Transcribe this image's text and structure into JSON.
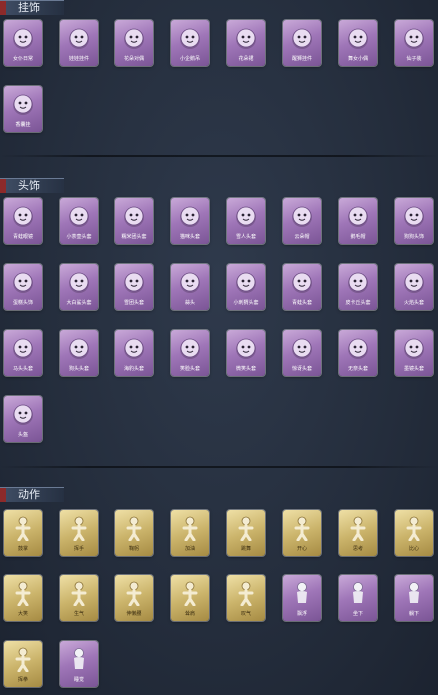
{
  "sections": [
    {
      "id": "pendant",
      "title": "挂饰",
      "items": [
        {
          "label": "女仆日常",
          "icon": "doll-icon",
          "tone": "purple"
        },
        {
          "label": "娃娃挂件",
          "icon": "girl-doll-icon",
          "tone": "purple"
        },
        {
          "label": "花朵对偶",
          "icon": "flower-doll-icon",
          "tone": "purple"
        },
        {
          "label": "小企鹅吊",
          "icon": "penguin-icon",
          "tone": "purple"
        },
        {
          "label": "花朵裙",
          "icon": "flower-dress-icon",
          "tone": "purple"
        },
        {
          "label": "醒狮挂件",
          "icon": "lion-icon",
          "tone": "purple"
        },
        {
          "label": "舞女小偶",
          "icon": "dancer-icon",
          "tone": "purple"
        },
        {
          "label": "仙子装",
          "icon": "fairy-icon",
          "tone": "purple"
        },
        {
          "label": "香囊挂",
          "icon": "sachet-icon",
          "tone": "purple"
        }
      ]
    },
    {
      "id": "headwear",
      "title": "头饰",
      "items": [
        {
          "label": "青蛙眼镜",
          "icon": "frog-icon",
          "tone": "purple"
        },
        {
          "label": "小茶壶头套",
          "icon": "teapot-icon",
          "tone": "purple"
        },
        {
          "label": "糯米团头套",
          "icon": "rice-ball-icon",
          "tone": "purple"
        },
        {
          "label": "猫咪头套",
          "icon": "cat-head-icon",
          "tone": "purple"
        },
        {
          "label": "雪人头套",
          "icon": "snowman-icon",
          "tone": "purple"
        },
        {
          "label": "云朵帽",
          "icon": "cloud-icon",
          "tone": "purple"
        },
        {
          "label": "鹅毛帽",
          "icon": "bird-icon",
          "tone": "purple"
        },
        {
          "label": "狗狗头饰",
          "icon": "dog-head-icon",
          "tone": "purple"
        },
        {
          "label": "蛋糕头饰",
          "icon": "cake-icon",
          "tone": "purple"
        },
        {
          "label": "大白鲨头套",
          "icon": "shark-icon",
          "tone": "purple"
        },
        {
          "label": "雪团头套",
          "icon": "snowball-icon",
          "tone": "purple"
        },
        {
          "label": "蒜头",
          "icon": "garlic-icon",
          "tone": "purple"
        },
        {
          "label": "小刺猬头套",
          "icon": "hedgehog-icon",
          "tone": "purple"
        },
        {
          "label": "青蛙头套",
          "icon": "green-frog-icon",
          "tone": "purple"
        },
        {
          "label": "皮卡丘头套",
          "icon": "pikachu-icon",
          "tone": "purple"
        },
        {
          "label": "火焰头套",
          "icon": "fire-icon",
          "tone": "purple"
        },
        {
          "label": "马头头套",
          "icon": "horse-icon",
          "tone": "purple"
        },
        {
          "label": "狗头头套",
          "icon": "doberman-icon",
          "tone": "purple"
        },
        {
          "label": "海豹头套",
          "icon": "seal-icon",
          "tone": "purple"
        },
        {
          "label": "笑脸头套",
          "icon": "grin-icon",
          "tone": "purple"
        },
        {
          "label": "微笑头套",
          "icon": "smile-icon",
          "tone": "purple"
        },
        {
          "label": "惊讶头套",
          "icon": "surprise-icon",
          "tone": "purple"
        },
        {
          "label": "无奈头套",
          "icon": "meh-icon",
          "tone": "purple"
        },
        {
          "label": "墨镜头套",
          "icon": "sunglasses-icon",
          "tone": "purple"
        },
        {
          "label": "头盔",
          "icon": "helmet-icon",
          "tone": "purple"
        }
      ]
    },
    {
      "id": "action",
      "title": "动作",
      "items": [
        {
          "label": "鼓掌",
          "icon": "pose-icon",
          "tone": "gold"
        },
        {
          "label": "挥手",
          "icon": "pose-icon",
          "tone": "gold"
        },
        {
          "label": "鞠躬",
          "icon": "pose-icon",
          "tone": "gold"
        },
        {
          "label": "加油",
          "icon": "pose-icon",
          "tone": "gold"
        },
        {
          "label": "跳舞",
          "icon": "pose-icon",
          "tone": "gold"
        },
        {
          "label": "开心",
          "icon": "pose-icon",
          "tone": "gold"
        },
        {
          "label": "思考",
          "icon": "pose-icon",
          "tone": "gold"
        },
        {
          "label": "比心",
          "icon": "pose-icon",
          "tone": "gold"
        },
        {
          "label": "大笑",
          "icon": "pose-icon",
          "tone": "gold"
        },
        {
          "label": "生气",
          "icon": "pose-icon",
          "tone": "gold"
        },
        {
          "label": "伸懒腰",
          "icon": "pose-icon",
          "tone": "gold"
        },
        {
          "label": "耸肩",
          "icon": "pose-icon",
          "tone": "gold"
        },
        {
          "label": "叹气",
          "icon": "pose-icon",
          "tone": "gold"
        },
        {
          "label": "飘浮",
          "icon": "ghost-pose-icon",
          "tone": "purple"
        },
        {
          "label": "坐下",
          "icon": "ghost-pose-icon",
          "tone": "purple"
        },
        {
          "label": "躺下",
          "icon": "ghost-pose-icon",
          "tone": "purple"
        },
        {
          "label": "挥拳",
          "icon": "pose-icon",
          "tone": "gold"
        },
        {
          "label": "睡觉",
          "icon": "sleep-pose-icon",
          "tone": "purple"
        }
      ]
    }
  ]
}
